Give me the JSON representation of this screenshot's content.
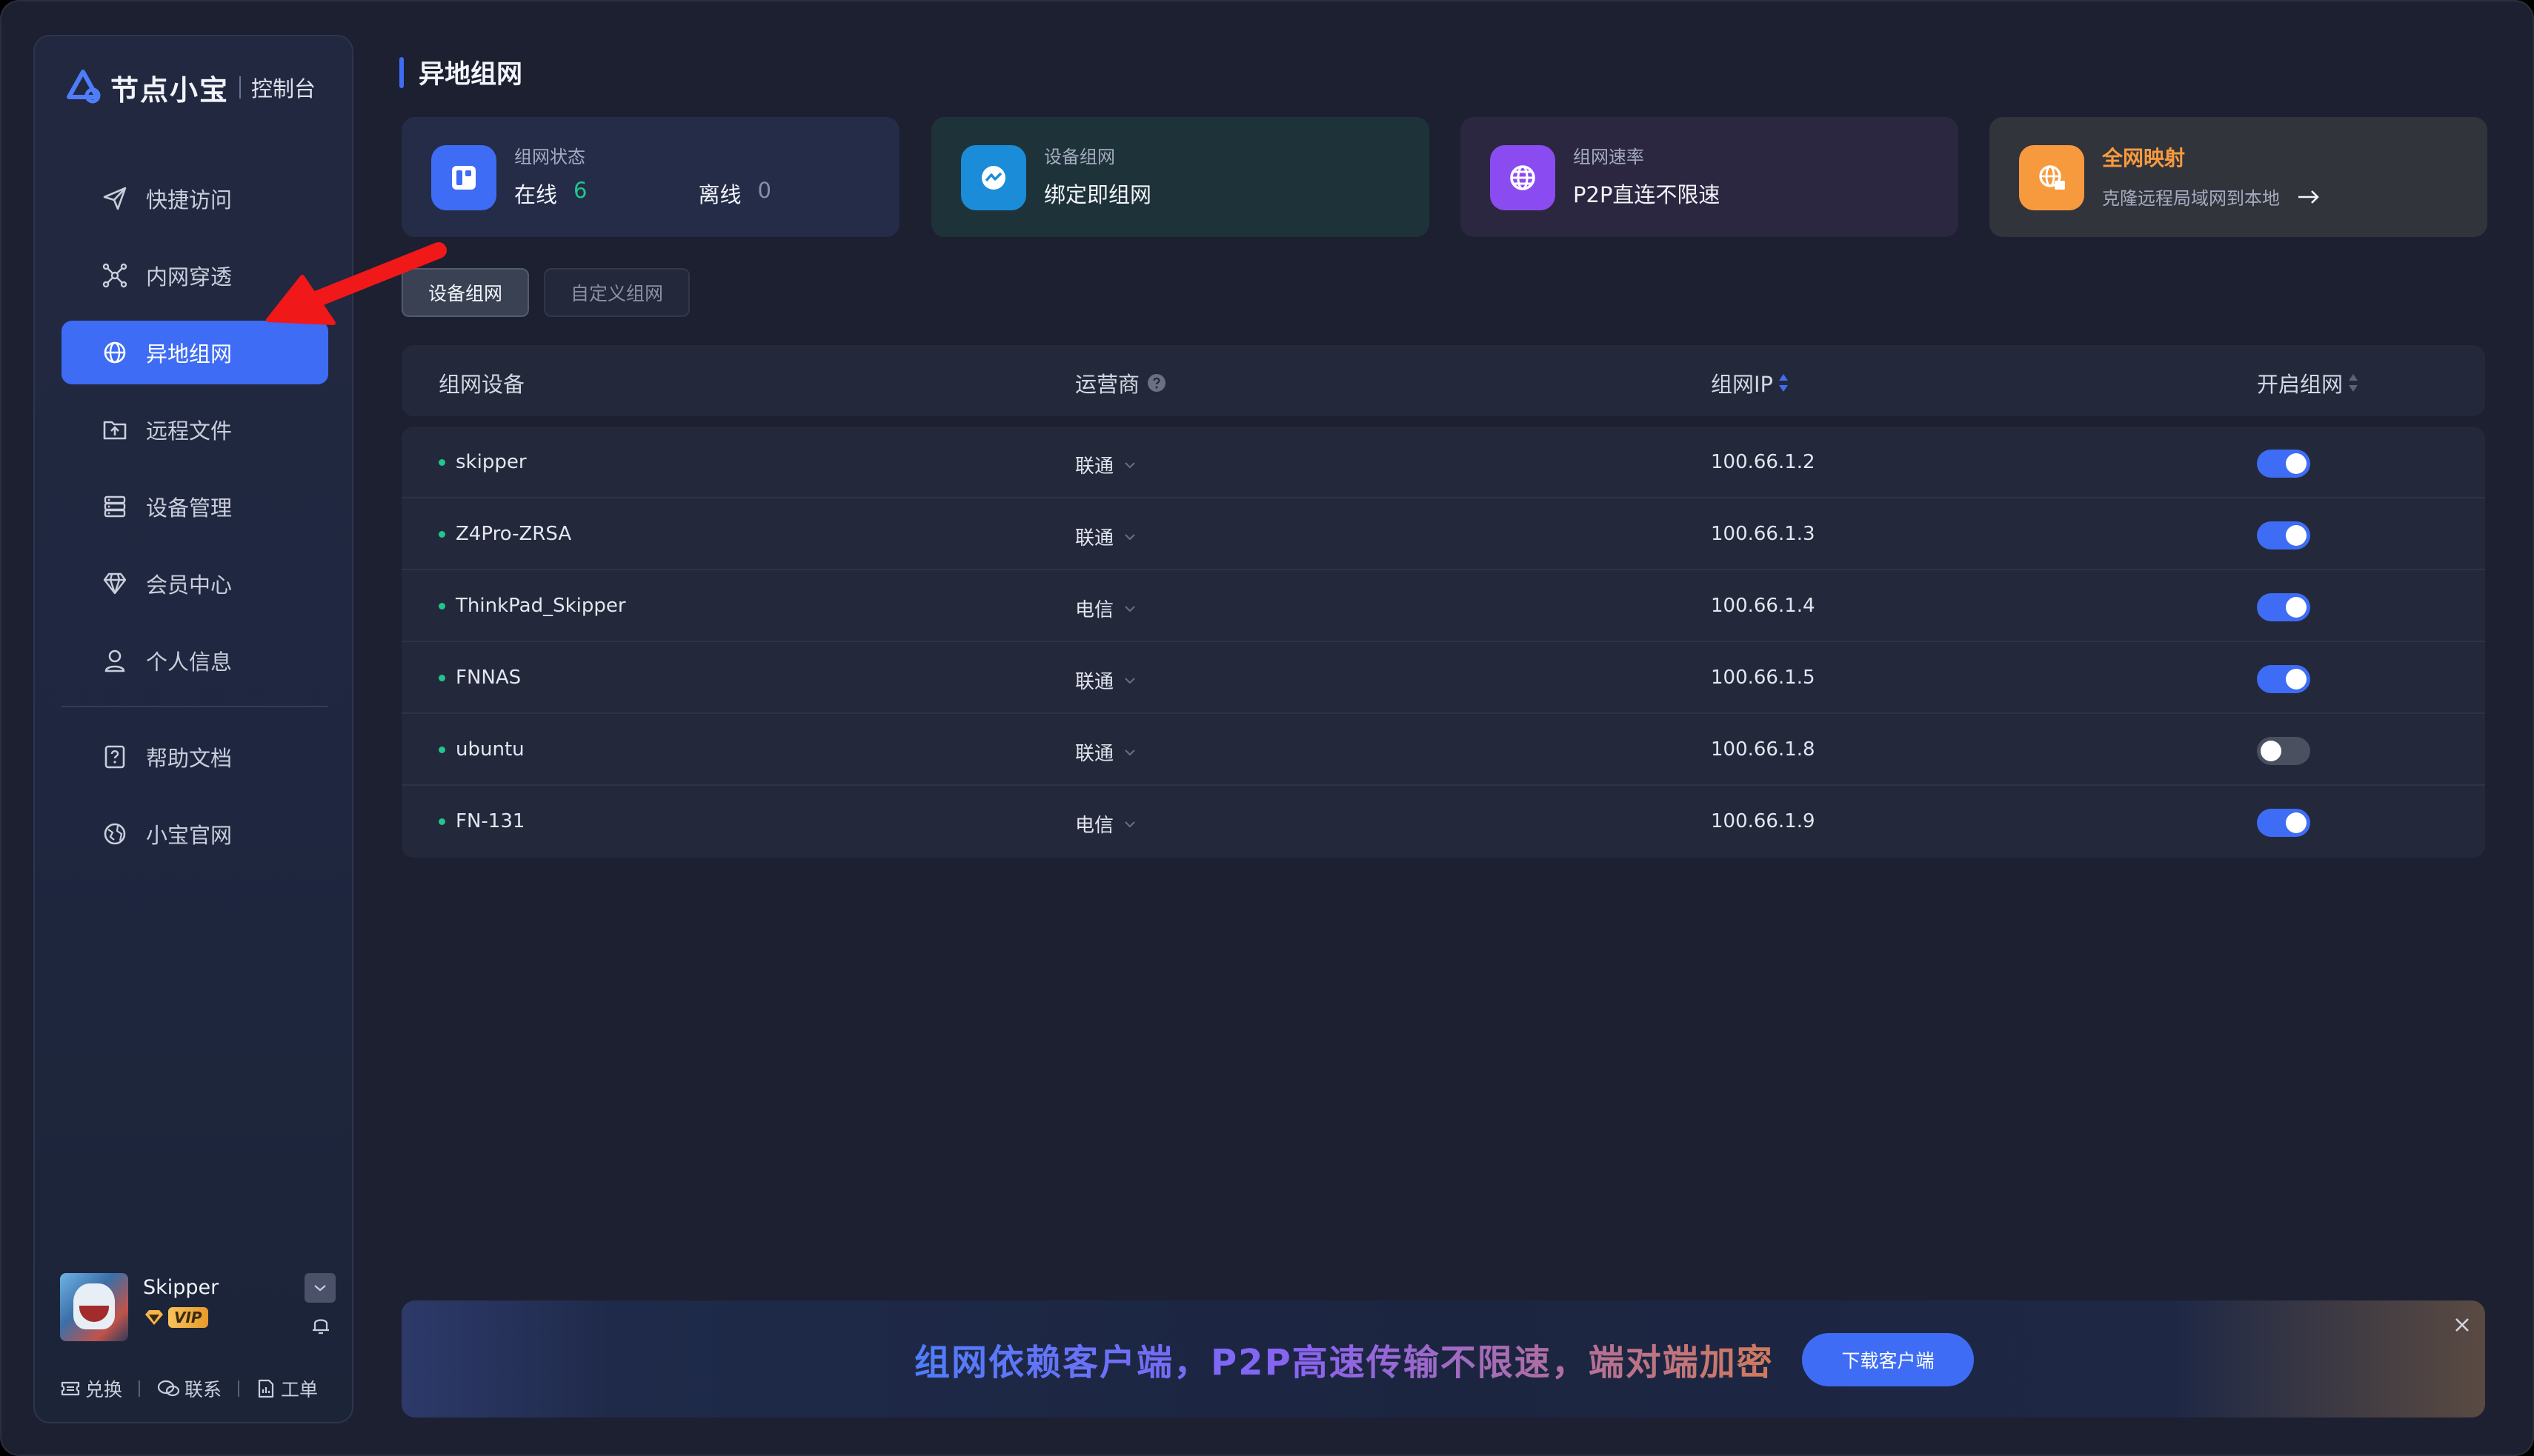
{
  "brand": {
    "name": "节点小宝",
    "sub": "控制台"
  },
  "sidebar": {
    "items": [
      {
        "label": "快捷访问",
        "icon": "send-icon"
      },
      {
        "label": "内网穿透",
        "icon": "network-icon"
      },
      {
        "label": "异地组网",
        "icon": "globe-icon",
        "active": true
      },
      {
        "label": "远程文件",
        "icon": "folder-upload-icon"
      },
      {
        "label": "设备管理",
        "icon": "server-icon"
      },
      {
        "label": "会员中心",
        "icon": "diamond-icon"
      },
      {
        "label": "个人信息",
        "icon": "user-icon"
      }
    ],
    "items2": [
      {
        "label": "帮助文档",
        "icon": "help-doc-icon"
      },
      {
        "label": "小宝官网",
        "icon": "website-icon"
      }
    ]
  },
  "user": {
    "name": "Skipper",
    "vip": "VIP"
  },
  "footer": {
    "redeem": "兑换",
    "contact": "联系",
    "ticket": "工单"
  },
  "page": {
    "title": "异地组网"
  },
  "cards": {
    "status": {
      "label": "组网状态",
      "online_label": "在线",
      "online_count": "6",
      "offline_label": "离线",
      "offline_count": "0"
    },
    "device": {
      "label": "设备组网",
      "value": "绑定即组网"
    },
    "speed": {
      "label": "组网速率",
      "value": "P2P直连不限速"
    },
    "mapping": {
      "title": "全网映射",
      "desc": "克隆远程局域网到本地"
    }
  },
  "tabs": [
    {
      "label": "设备组网",
      "active": true
    },
    {
      "label": "自定义组网",
      "active": false
    }
  ],
  "table": {
    "headers": {
      "device": "组网设备",
      "carrier": "运营商",
      "ip": "组网IP",
      "enable": "开启组网"
    },
    "rows": [
      {
        "name": "skipper",
        "carrier": "联通",
        "ip": "100.66.1.2",
        "enabled": true
      },
      {
        "name": "Z4Pro-ZRSA",
        "carrier": "联通",
        "ip": "100.66.1.3",
        "enabled": true
      },
      {
        "name": "ThinkPad_Skipper",
        "carrier": "电信",
        "ip": "100.66.1.4",
        "enabled": true
      },
      {
        "name": "FNNAS",
        "carrier": "联通",
        "ip": "100.66.1.5",
        "enabled": true
      },
      {
        "name": "ubuntu",
        "carrier": "联通",
        "ip": "100.66.1.8",
        "enabled": false
      },
      {
        "name": "FN-131",
        "carrier": "电信",
        "ip": "100.66.1.9",
        "enabled": true
      }
    ]
  },
  "banner": {
    "text": "组网依赖客户端，P2P高速传输不限速，端对端加密",
    "button": "下载客户端"
  },
  "colors": {
    "accent": "#3e6cf4",
    "online": "#22c58b",
    "orange": "#f79a3e",
    "purple": "#8a4cf0"
  }
}
